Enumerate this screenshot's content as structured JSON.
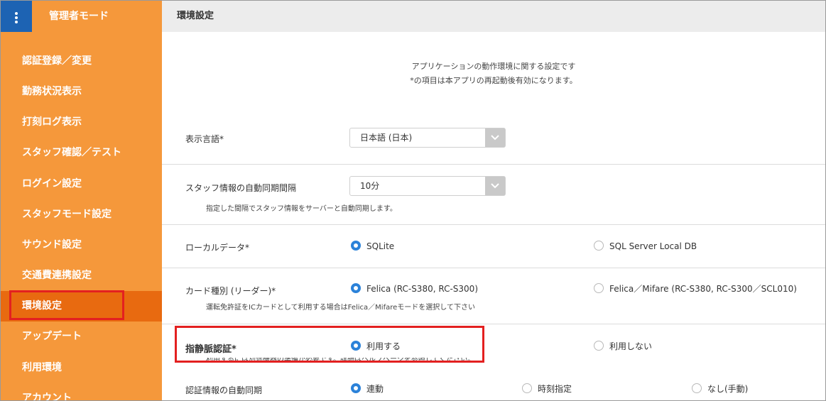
{
  "sidebar": {
    "menu_icon": "vertical-dots-icon",
    "title": "管理者モード",
    "items": [
      {
        "label": "認証登録／変更"
      },
      {
        "label": "勤務状況表示"
      },
      {
        "label": "打刻ログ表示"
      },
      {
        "label": "スタッフ確認／テスト"
      },
      {
        "label": "ログイン設定"
      },
      {
        "label": "スタッフモード設定"
      },
      {
        "label": "サウンド設定"
      },
      {
        "label": "交通費連携設定"
      },
      {
        "label": "環境設定"
      },
      {
        "label": "アップデート"
      },
      {
        "label": "利用環境"
      },
      {
        "label": "アカウント"
      }
    ],
    "active_index": 8
  },
  "header": {
    "title": "環境設定"
  },
  "intro": {
    "line1": "アプリケーションの動作環境に関する設定です",
    "line2": "*の項目は本アプリの再起動後有効になります。"
  },
  "settings": {
    "language": {
      "label": "表示言語*",
      "value": "日本語 (日本)"
    },
    "sync_interval": {
      "label": "スタッフ情報の自動同期間隔",
      "value": "10分",
      "help": "指定した間隔でスタッフ情報をサーバーと自動同期します。"
    },
    "local_data": {
      "label": "ローカルデータ*",
      "options": [
        "SQLite",
        "SQL Server Local DB"
      ],
      "selected": 0
    },
    "card_type": {
      "label": "カード種別 (リーダー)*",
      "options": [
        "Felica (RC-S380, RC-S300)",
        "Felica／Mifare (RC-S380, RC-S300／SCL010)"
      ],
      "selected": 0,
      "help": "運転免許証をICカードとして利用する場合はFelica／Mifareモードを選択して下さい"
    },
    "vein_auth": {
      "label": "指静脈認証*",
      "options": [
        "利用する",
        "利用しない"
      ],
      "selected": 0,
      "help": "利用するには別途機器の準備が必要です。詳細はヘルプページを参照してください。"
    },
    "auth_sync": {
      "label": "認証情報の自動同期",
      "options": [
        "連動",
        "時刻指定",
        "なし(手動)"
      ],
      "selected": 0
    }
  },
  "colors": {
    "sidebar": "#f5983b",
    "sidebar_active": "#e86a10",
    "menu_button": "#1d63b3",
    "radio_on": "#2b82d9",
    "highlight": "#e32020"
  }
}
